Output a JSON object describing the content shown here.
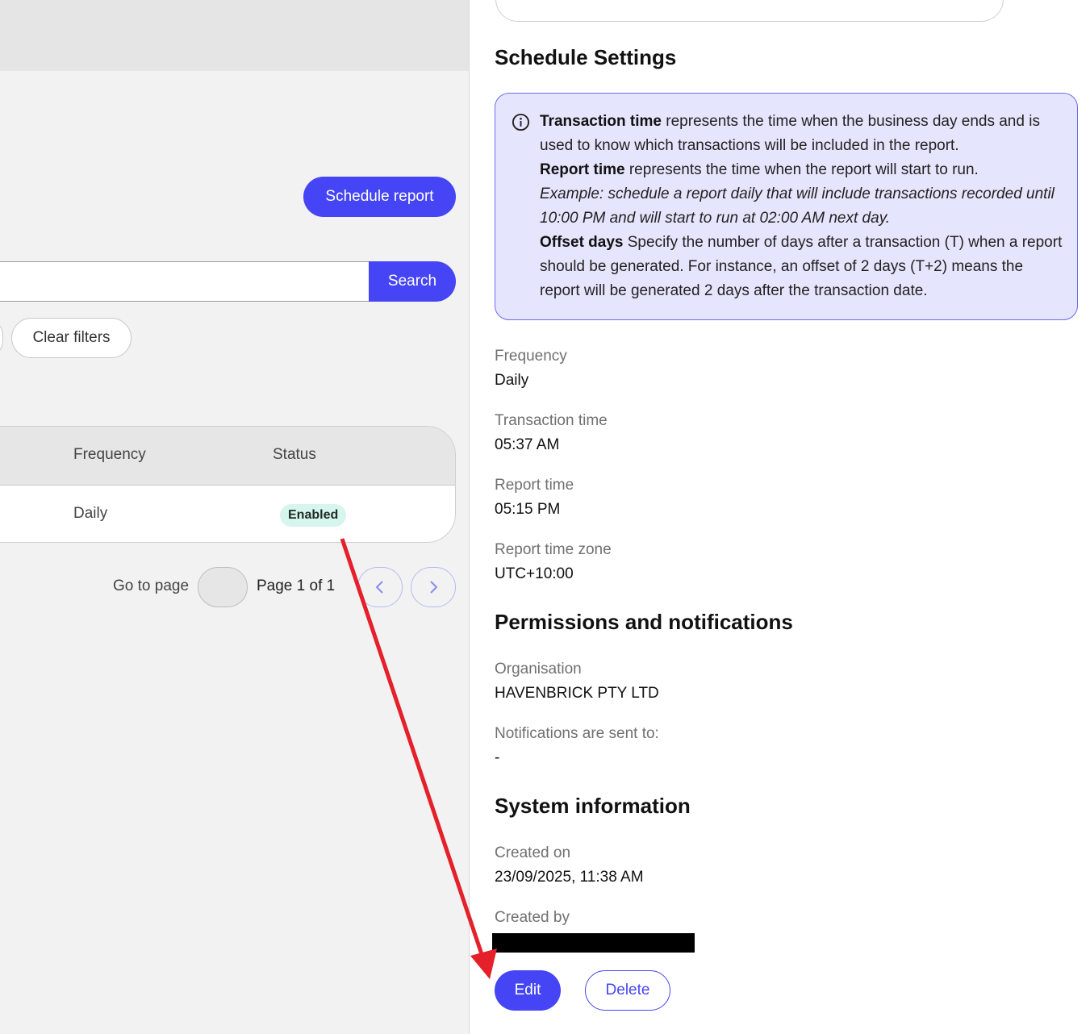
{
  "list_panel": {
    "schedule_button": "Schedule report",
    "search_button": "Search",
    "search_placeholder": "",
    "clear_filters": "Clear filters",
    "table": {
      "columns": [
        "Frequency",
        "Status"
      ],
      "rows": [
        {
          "frequency": "Daily",
          "status": "Enabled"
        }
      ]
    },
    "pagination": {
      "goto_label": "Go to page",
      "page_label": "Page 1 of 1",
      "prev_icon": "chevron-left-icon",
      "next_icon": "chevron-right-icon"
    }
  },
  "details": {
    "schedule_settings_title": "Schedule Settings",
    "info": {
      "icon": "info-icon",
      "transaction_time_term": "Transaction time",
      "transaction_time_text": " represents the time when the business day ends and is used to know which transactions will be included in the report.",
      "report_time_term": "Report time",
      "report_time_text": " represents the time when the report will start to run.",
      "example": "Example: schedule a report daily that will include transactions recorded until 10:00 PM and will start to run at 02:00 AM next day.",
      "offset_days_term": "Offset days",
      "offset_days_text": " Specify the number of days after a transaction (T) when a re­port should be generated. For instance, an offset of 2 days (T+2) means the report will be generated 2 days after the transaction date."
    },
    "fields": {
      "frequency_label": "Frequency",
      "frequency_value": "Daily",
      "transaction_time_label": "Transaction time",
      "transaction_time_value": "05:37 AM",
      "report_time_label": "Report time",
      "report_time_value": "05:15 PM",
      "report_time_zone_label": "Report time zone",
      "report_time_zone_value": "UTC+10:00"
    },
    "permissions_title": "Permissions and notifications",
    "organisation_label": "Organisation",
    "organisation_value": "HAVENBRICK PTY LTD",
    "notifications_label": "Notifications are sent to:",
    "notifications_value": "-",
    "system_title": "System information",
    "created_on_label": "Created on",
    "created_on_value": "23/09/2025, 11:38 AM",
    "created_by_label": "Created by",
    "edit_button": "Edit",
    "delete_button": "Delete"
  },
  "colors": {
    "primary": "#4545f5",
    "info_bg": "#e5e5fd",
    "annotation_arrow": "#e4202a",
    "badge_bg": "#d6f5ec"
  }
}
